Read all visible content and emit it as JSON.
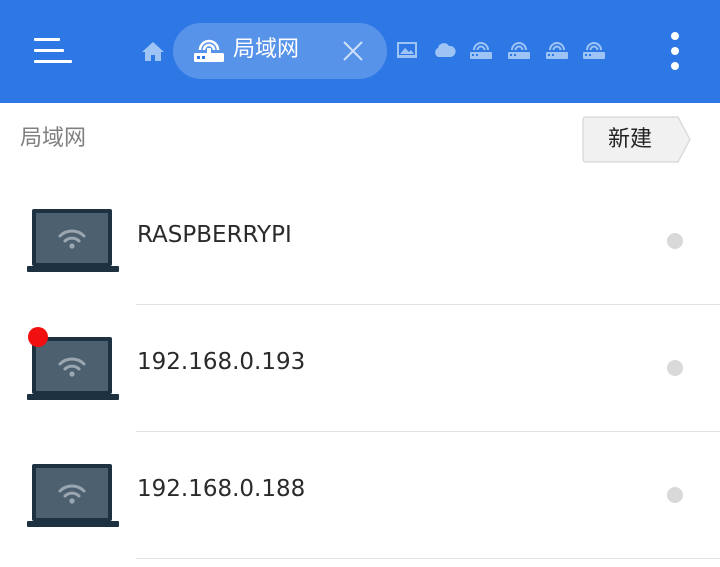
{
  "header": {
    "menu_icon": "hamburger-menu-icon",
    "home_icon": "home-icon",
    "active_tab": {
      "label": "局域网",
      "icon": "lan-router-icon",
      "close_icon": "close-icon"
    },
    "other_tabs": [
      "image-icon",
      "cloud-icon",
      "lan-router-icon",
      "lan-router-icon",
      "lan-router-icon",
      "lan-router-icon"
    ],
    "more_icon": "more-vertical-icon"
  },
  "toolbar": {
    "breadcrumb": "局域网",
    "new_button_label": "新建"
  },
  "devices": [
    {
      "name": "RASPBERRYPI",
      "icon": "laptop-wifi-icon",
      "has_badge": false
    },
    {
      "name": "192.168.0.193",
      "icon": "laptop-wifi-icon",
      "has_badge": true
    },
    {
      "name": "192.168.0.188",
      "icon": "laptop-wifi-icon",
      "has_badge": false
    }
  ],
  "colors": {
    "header_bg": "#2d78e4",
    "text_primary": "#2a2a2a",
    "text_secondary": "#808080",
    "badge_red": "#f20f0f",
    "laptop_frame": "#1e3140",
    "laptop_screen": "#4d6070"
  }
}
